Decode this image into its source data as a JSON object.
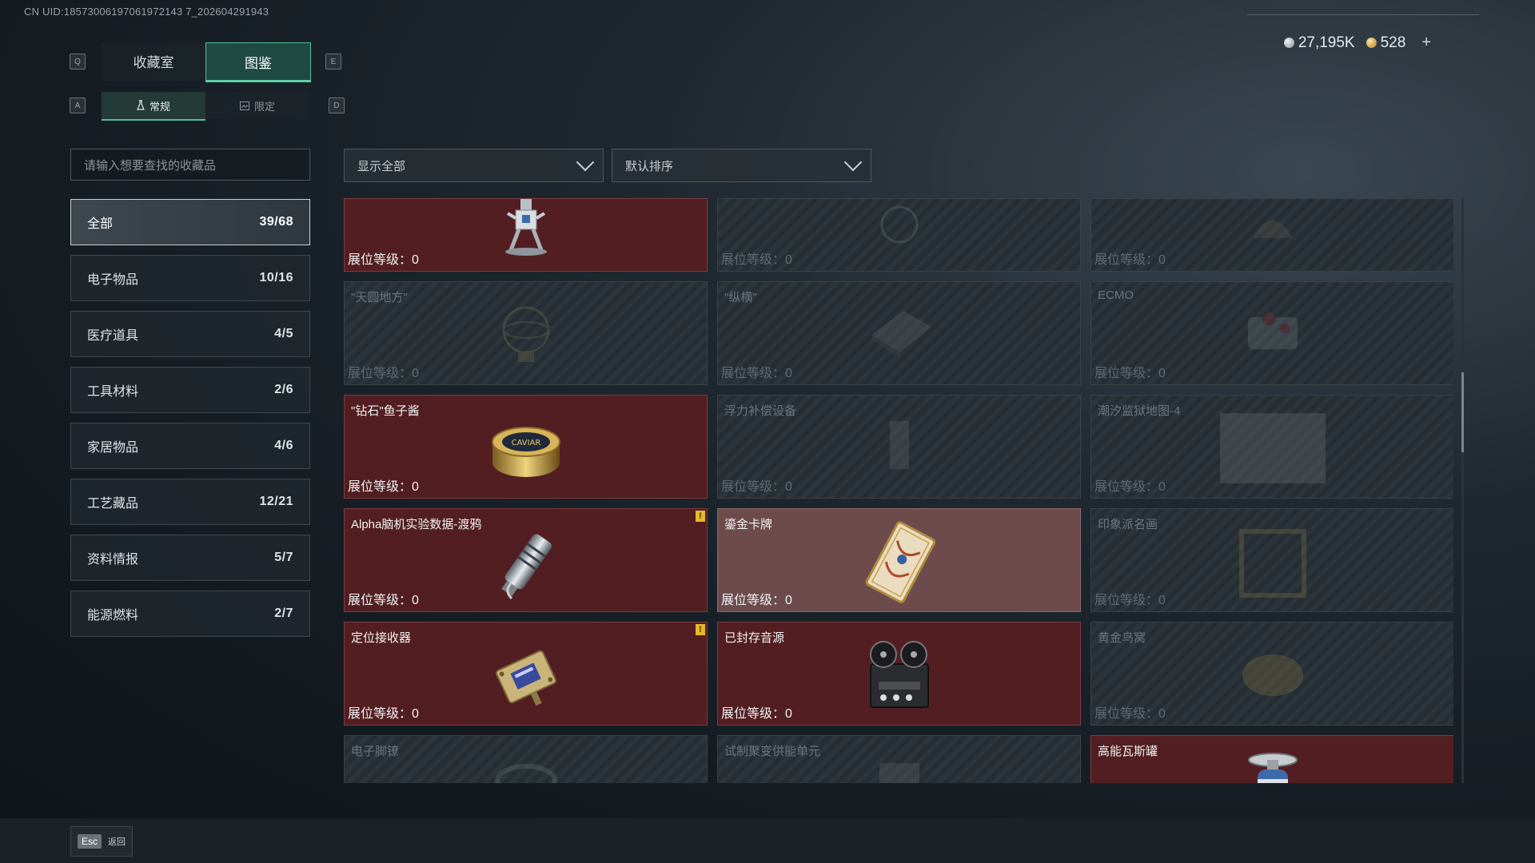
{
  "uid": "CN UID:18573006197061972143 7_202604291943",
  "currency": {
    "silver": "27,195K",
    "gold": "528",
    "plus": "+"
  },
  "keys": {
    "q": "Q",
    "e": "E",
    "a": "A",
    "d": "D"
  },
  "tabs": [
    {
      "label": "收藏室",
      "active": false
    },
    {
      "label": "图鉴",
      "active": true
    }
  ],
  "subtabs": [
    {
      "label": "常规",
      "active": true
    },
    {
      "label": "限定",
      "active": false
    }
  ],
  "search": {
    "placeholder": "请输入想要查找的收藏品"
  },
  "filters": {
    "show": "显示全部",
    "sort": "默认排序"
  },
  "categories": [
    {
      "label": "全部",
      "count": "39/68",
      "active": true
    },
    {
      "label": "电子物品",
      "count": "10/16"
    },
    {
      "label": "医疗道具",
      "count": "4/5"
    },
    {
      "label": "工具材料",
      "count": "2/6"
    },
    {
      "label": "家居物品",
      "count": "4/6"
    },
    {
      "label": "工艺藏品",
      "count": "12/21"
    },
    {
      "label": "资料情报",
      "count": "5/7"
    },
    {
      "label": "能源燃料",
      "count": "2/7"
    }
  ],
  "items": [
    {
      "name": "",
      "level": "展位等级：0",
      "owned": true,
      "icon": "robot-figure-icon"
    },
    {
      "name": "",
      "level": "展位等级：0",
      "owned": false,
      "icon": "globe-icon"
    },
    {
      "name": "",
      "level": "展位等级：0",
      "owned": false,
      "icon": "dome-icon"
    },
    {
      "name": "\"天圆地方\"",
      "level": "展位等级：0",
      "owned": false,
      "icon": "armillary-icon"
    },
    {
      "name": "\"纵横\"",
      "level": "展位等级：0",
      "owned": false,
      "icon": "chessboard-icon"
    },
    {
      "name": "ECMO",
      "level": "展位等级：0",
      "owned": false,
      "icon": "medical-device-icon"
    },
    {
      "name": "\"钻石\"鱼子酱",
      "level": "展位等级：0",
      "owned": true,
      "icon": "caviar-tin-icon",
      "tin_text": "CAVIAR"
    },
    {
      "name": "浮力补偿设备",
      "level": "展位等级：0",
      "owned": false,
      "icon": "buoyancy-device-icon"
    },
    {
      "name": "潮汐监狱地图-4",
      "level": "展位等级：0",
      "owned": false,
      "icon": "map-icon"
    },
    {
      "name": "Alpha脑机实验数据-渡鸦",
      "level": "展位等级：0",
      "owned": true,
      "icon": "data-canister-icon",
      "alert": "!"
    },
    {
      "name": "鎏金卡牌",
      "level": "展位等级：0",
      "owned": true,
      "selected": true,
      "icon": "gilded-card-icon"
    },
    {
      "name": "印象派名画",
      "level": "展位等级：0",
      "owned": false,
      "icon": "painting-icon"
    },
    {
      "name": "定位接收器",
      "level": "展位等级：0",
      "owned": true,
      "icon": "receiver-icon",
      "alert": "!"
    },
    {
      "name": "已封存音源",
      "level": "展位等级：0",
      "owned": true,
      "icon": "reel-recorder-icon"
    },
    {
      "name": "黄金鸟窝",
      "level": "展位等级：0",
      "owned": false,
      "icon": "golden-nest-icon"
    },
    {
      "name": "电子脚镣",
      "level": "",
      "owned": false,
      "icon": "ankle-monitor-icon"
    },
    {
      "name": "试制聚变供能单元",
      "level": "",
      "owned": false,
      "icon": "fusion-cell-icon"
    },
    {
      "name": "高能瓦斯罐",
      "level": "",
      "owned": true,
      "icon": "gas-canister-icon"
    }
  ],
  "footer": {
    "esc_key": "Esc",
    "esc_label": "返回"
  },
  "colors": {
    "accent": "#4fbf98",
    "owned_card": "#531e22",
    "alert": "#e7b829"
  }
}
